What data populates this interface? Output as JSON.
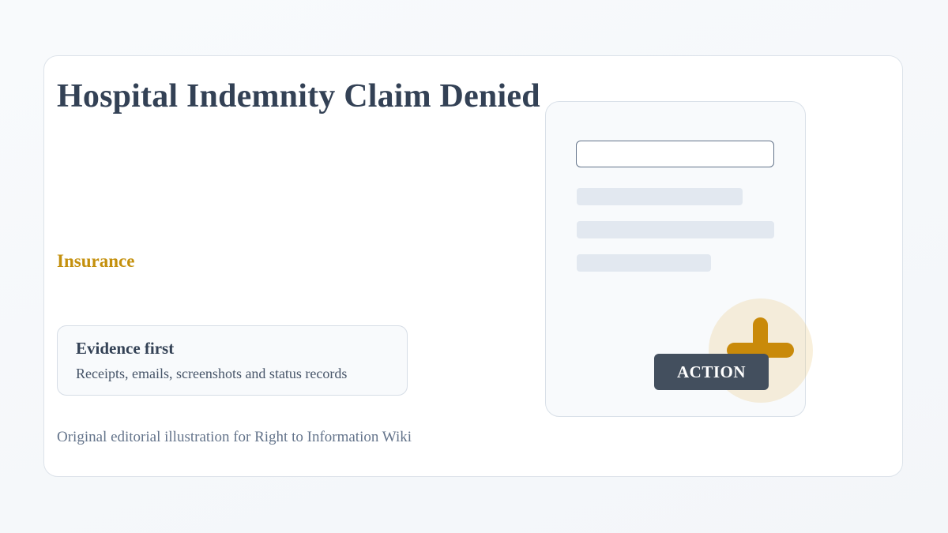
{
  "article": {
    "title": "Hospital Indemnity Claim Denied",
    "category": "Insurance",
    "caption": "Original editorial illustration for Right to Information Wiki"
  },
  "evidence": {
    "title": "Evidence first",
    "text": "Receipts, emails, screenshots and status records"
  },
  "illustration": {
    "action_label": "ACTION",
    "badge_icon": "plus-icon"
  },
  "colors": {
    "title": "#334155",
    "accent": "#c98a0a",
    "button": "#434f5e",
    "muted": "#64748b"
  }
}
